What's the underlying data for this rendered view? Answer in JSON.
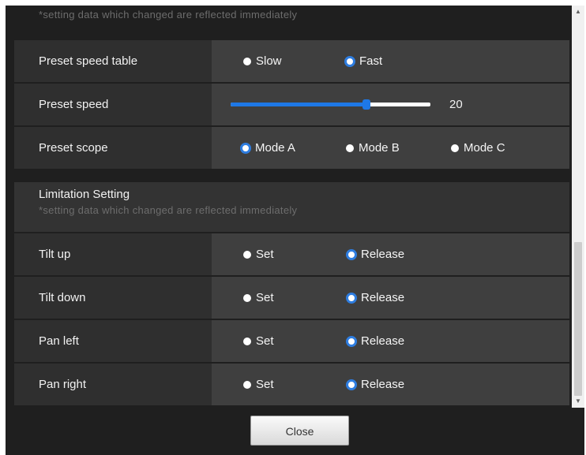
{
  "preset_section": {
    "note": "*setting data which changed are reflected immediately",
    "rows": [
      {
        "label": "Preset speed table",
        "options": [
          "Slow",
          "Fast"
        ],
        "selected": "Fast"
      },
      {
        "label": "Preset speed",
        "slider_value": "20",
        "slider_fraction": 0.68
      },
      {
        "label": "Preset scope",
        "options": [
          "Mode A",
          "Mode B",
          "Mode C"
        ],
        "selected": "Mode A"
      }
    ]
  },
  "limitation_section": {
    "title": "Limitation Setting",
    "note": "*setting data which changed are reflected immediately",
    "rows": [
      {
        "label": "Tilt up",
        "options": [
          "Set",
          "Release"
        ],
        "selected": "Release"
      },
      {
        "label": "Tilt down",
        "options": [
          "Set",
          "Release"
        ],
        "selected": "Release"
      },
      {
        "label": "Pan left",
        "options": [
          "Set",
          "Release"
        ],
        "selected": "Release"
      },
      {
        "label": "Pan right",
        "options": [
          "Set",
          "Release"
        ],
        "selected": "Release"
      }
    ]
  },
  "footer": {
    "close_label": "Close"
  },
  "colors": {
    "accent": "#1e78e6",
    "row_bg": "#3f3f3f",
    "label_bg": "#2f2f2f"
  }
}
